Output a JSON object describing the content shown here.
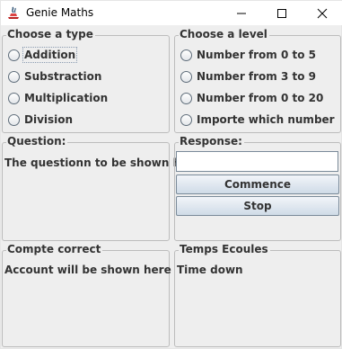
{
  "window": {
    "title": "Genie Maths",
    "icon": "java-app-icon"
  },
  "type_panel": {
    "title": "Choose a type",
    "options": [
      "Addition",
      "Substraction",
      "Multiplication",
      "Division"
    ]
  },
  "level_panel": {
    "title": "Choose a level",
    "options": [
      "Number from 0 to 5",
      "Number from 3 to 9",
      "Number from 0 to 20",
      "Importe which number"
    ]
  },
  "question_panel": {
    "title": "Question:",
    "text": "The questionn to be shown here"
  },
  "response_panel": {
    "title": "Response:",
    "input_value": "",
    "commence_label": "Commence",
    "stop_label": "Stop"
  },
  "count_panel": {
    "title": "Compte correct",
    "text": "Account will be shown here"
  },
  "time_panel": {
    "title": "Temps Ecoules",
    "text": "Time down"
  }
}
